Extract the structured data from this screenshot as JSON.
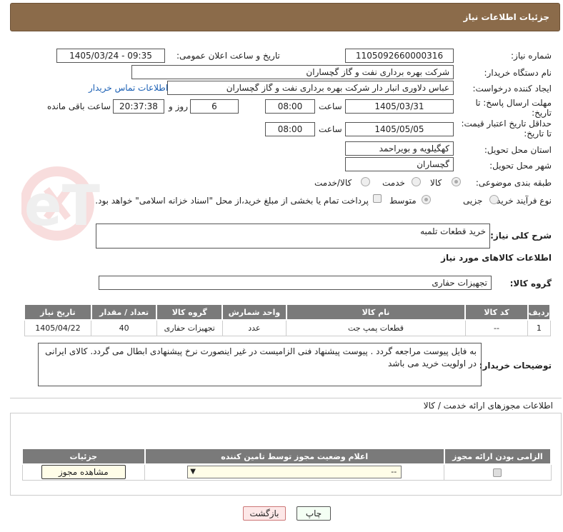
{
  "header": {
    "title": "جزئیات اطلاعات نیاز"
  },
  "fields": {
    "need_number_label": "شماره نیاز:",
    "need_number": "1105092660000316",
    "announce_label": "تاریخ و ساعت اعلان عمومی:",
    "announce_value": "1405/03/24 - 09:35",
    "buyer_org_label": "نام دستگاه خریدار:",
    "buyer_org": "شرکت بهره برداری نفت و گاز گچساران",
    "creator_label": "ایجاد کننده درخواست:",
    "creator": "عباس دلاوری انبار دار شرکت بهره برداری نفت و گاز گچساران",
    "contact_link": "اطلاعات تماس خریدار",
    "reply_deadline_label": "مهلت ارسال پاسخ: تا تاریخ:",
    "reply_date": "1405/03/31",
    "time_label": "ساعت",
    "reply_time": "08:00",
    "days_value": "6",
    "days_label": "روز و",
    "remaining_time": "20:37:38",
    "remaining_label": "ساعت باقی مانده",
    "price_deadline_label": "حداقل تاریخ اعتبار قیمت: تا تاریخ:",
    "price_date": "1405/05/05",
    "price_time": "08:00",
    "province_label": "استان محل تحویل:",
    "province": "کهگیلویه و بویراحمد",
    "city_label": "شهر محل تحویل:",
    "city": "گچساران",
    "category_label": "طبقه بندی موضوعی:",
    "category_options": [
      "کالا",
      "خدمت",
      "کالا/خدمت"
    ],
    "process_label": "نوع فرآیند خرید :",
    "process_options": [
      "جزیی",
      "متوسط"
    ],
    "payment_text": "پرداخت تمام یا بخشی از مبلغ خرید،از محل \"اسناد خزانه اسلامی\" خواهد بود."
  },
  "description": {
    "label": "شرح کلی نیاز:",
    "value": "خرید قطعات تلمبه"
  },
  "goods": {
    "section_title": "اطلاعات کالاهای مورد نیاز",
    "group_label": "گروه کالا:",
    "group_value": "تجهیزات حفاری",
    "columns": [
      "ردیف",
      "کد کالا",
      "نام کالا",
      "واحد شمارش",
      "گروه کالا",
      "تعداد / مقدار",
      "تاریخ نیاز"
    ],
    "rows": [
      [
        "1",
        "--",
        "قطعات پمپ جت",
        "عدد",
        "تجهیزات حفاری",
        "40",
        "1405/04/22"
      ]
    ]
  },
  "buyer_notes": {
    "label": "توضیحات خریدار:",
    "value": "به فایل پیوست مراجعه گردد . پیوست پیشنهاد فنی الزامیست در غیر اینصورت نرخ پیشنهادی ابطال می گردد. کالای ایرانی در اولویت خرید می باشد"
  },
  "permits": {
    "section_title": "اطلاعات مجوزهای ارائه خدمت / کالا",
    "columns": [
      "الزامی بودن ارائه مجوز",
      "اعلام وضعیت مجوز توسط تامین کننده",
      "جزئیات"
    ],
    "select_value": "--",
    "view_button": "مشاهده مجوز"
  },
  "footer": {
    "print_button": "چاپ",
    "back_button": "بازگشت"
  },
  "watermark_text": "AriaTender.neT",
  "colors": {
    "header": "#8b6b4a",
    "table_header": "#7a7a7a",
    "link": "#1a5fb4",
    "back_button": "#fde8e8"
  }
}
